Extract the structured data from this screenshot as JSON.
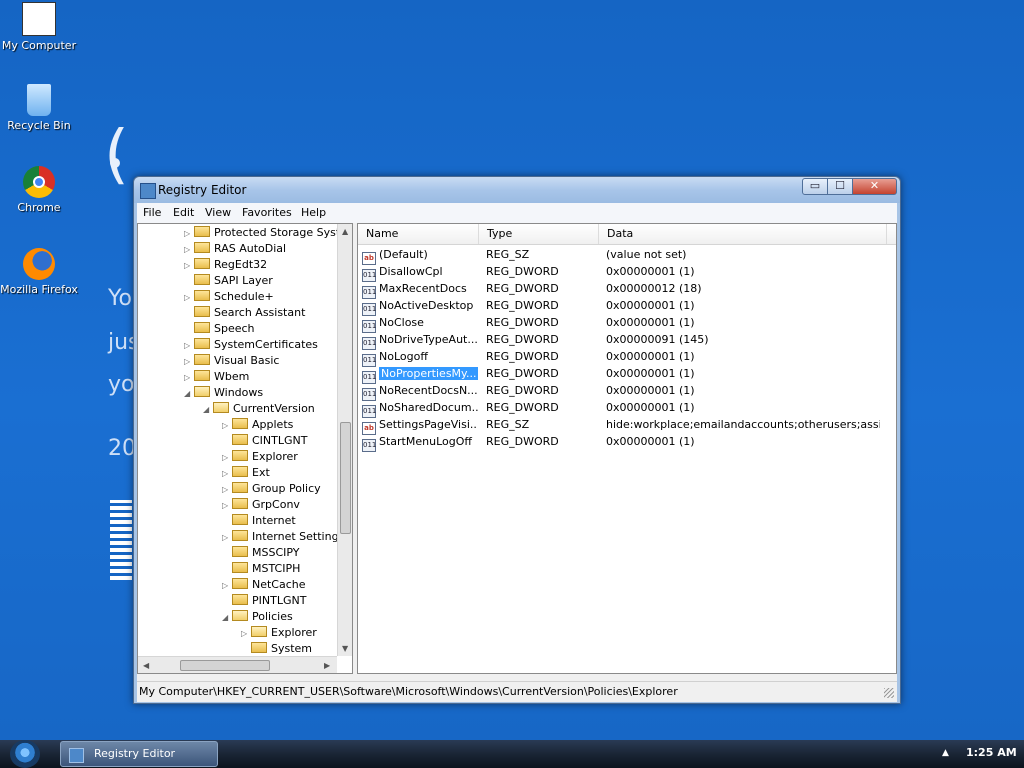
{
  "desktop": {
    "icons": [
      {
        "label": "My Computer"
      },
      {
        "label": "Recycle Bin"
      },
      {
        "label": "Chrome"
      },
      {
        "label": "Mozilla Firefox"
      }
    ],
    "background_fragments": {
      "sad": "(",
      "line1": "Yo",
      "line2": "jus",
      "line3": "yo",
      "line4": "20"
    }
  },
  "window": {
    "title": "Registry Editor",
    "buttons": {
      "minimize": "▭",
      "maximize": "☐",
      "close": "✕"
    },
    "menu": [
      "File",
      "Edit",
      "View",
      "Favorites",
      "Help"
    ],
    "tree": [
      {
        "label": "Protected Storage Syst",
        "expander": "▷",
        "open": false
      },
      {
        "label": "RAS AutoDial",
        "expander": "▷",
        "open": false
      },
      {
        "label": "RegEdt32",
        "expander": "▷",
        "open": false
      },
      {
        "label": "SAPI Layer",
        "expander": "",
        "open": false
      },
      {
        "label": "Schedule+",
        "expander": "▷",
        "open": false
      },
      {
        "label": "Search Assistant",
        "expander": "",
        "open": false
      },
      {
        "label": "Speech",
        "expander": "",
        "open": false
      },
      {
        "label": "SystemCertificates",
        "expander": "▷",
        "open": false
      },
      {
        "label": "Visual Basic",
        "expander": "▷",
        "open": false
      },
      {
        "label": "Wbem",
        "expander": "▷",
        "open": false
      },
      {
        "label": "Windows",
        "expander": "◢",
        "open": true
      },
      {
        "label": "CurrentVersion",
        "expander": "◢",
        "open": true
      },
      {
        "label": "Applets",
        "expander": "▷",
        "open": false
      },
      {
        "label": "CINTLGNT",
        "expander": "",
        "open": false
      },
      {
        "label": "Explorer",
        "expander": "▷",
        "open": false
      },
      {
        "label": "Ext",
        "expander": "▷",
        "open": false
      },
      {
        "label": "Group Policy",
        "expander": "▷",
        "open": false
      },
      {
        "label": "GrpConv",
        "expander": "▷",
        "open": false
      },
      {
        "label": "Internet",
        "expander": "",
        "open": false
      },
      {
        "label": "Internet Setting",
        "expander": "▷",
        "open": false
      },
      {
        "label": "MSSCIPY",
        "expander": "",
        "open": false
      },
      {
        "label": "MSTCIPH",
        "expander": "",
        "open": false
      },
      {
        "label": "NetCache",
        "expander": "▷",
        "open": false
      },
      {
        "label": "PINTLGNT",
        "expander": "",
        "open": false
      },
      {
        "label": "Policies",
        "expander": "◢",
        "open": true
      },
      {
        "label": "Explorer",
        "expander": "▷",
        "open": true
      },
      {
        "label": "System",
        "expander": "",
        "open": false
      }
    ],
    "columns": {
      "name": "Name",
      "type": "Type",
      "data": "Data"
    },
    "values": [
      {
        "name": "(Default)",
        "type": "REG_SZ",
        "data": "(value not set)",
        "icon": "ab",
        "selected": false
      },
      {
        "name": "DisallowCpl",
        "type": "REG_DWORD",
        "data": "0x00000001 (1)",
        "icon": "dword",
        "selected": false
      },
      {
        "name": "MaxRecentDocs",
        "type": "REG_DWORD",
        "data": "0x00000012 (18)",
        "icon": "dword",
        "selected": false
      },
      {
        "name": "NoActiveDesktop",
        "type": "REG_DWORD",
        "data": "0x00000001 (1)",
        "icon": "dword",
        "selected": false
      },
      {
        "name": "NoClose",
        "type": "REG_DWORD",
        "data": "0x00000001 (1)",
        "icon": "dword",
        "selected": false
      },
      {
        "name": "NoDriveTypeAut...",
        "type": "REG_DWORD",
        "data": "0x00000091 (145)",
        "icon": "dword",
        "selected": false
      },
      {
        "name": "NoLogoff",
        "type": "REG_DWORD",
        "data": "0x00000001 (1)",
        "icon": "dword",
        "selected": false
      },
      {
        "name": "NoPropertiesMy...",
        "type": "REG_DWORD",
        "data": "0x00000001 (1)",
        "icon": "dword",
        "selected": true
      },
      {
        "name": "NoRecentDocsN...",
        "type": "REG_DWORD",
        "data": "0x00000001 (1)",
        "icon": "dword",
        "selected": false
      },
      {
        "name": "NoSharedDocum...",
        "type": "REG_DWORD",
        "data": "0x00000001 (1)",
        "icon": "dword",
        "selected": false
      },
      {
        "name": "SettingsPageVisi...",
        "type": "REG_SZ",
        "data": "hide:workplace;emailandaccounts;otherusers;assig...",
        "icon": "ab",
        "selected": false
      },
      {
        "name": "StartMenuLogOff",
        "type": "REG_DWORD",
        "data": "0x00000001 (1)",
        "icon": "dword",
        "selected": false
      }
    ],
    "status": "My Computer\\HKEY_CURRENT_USER\\Software\\Microsoft\\Windows\\CurrentVersion\\Policies\\Explorer"
  },
  "taskbar": {
    "task_label": "Registry Editor",
    "tray_arrow": "▲",
    "clock": "1:25 AM"
  }
}
